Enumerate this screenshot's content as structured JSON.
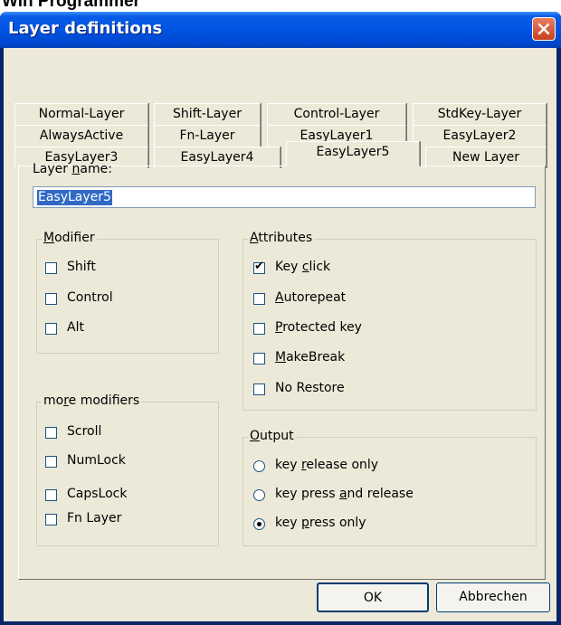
{
  "background_title": "Win Programmer",
  "window": {
    "title": "Layer definitions"
  },
  "tabs": {
    "row1": [
      "Normal-Layer",
      "Shift-Layer",
      "Control-Layer",
      "StdKey-Layer"
    ],
    "row2": [
      "AlwaysActive",
      "Fn-Layer",
      "EasyLayer1",
      "EasyLayer2"
    ],
    "row3": [
      "EasyLayer3",
      "EasyLayer4",
      "EasyLayer5",
      "New Layer"
    ],
    "selected": "EasyLayer5"
  },
  "layer_name": {
    "label_pre": "Layer ",
    "label_u": "n",
    "label_post": "ame:",
    "value": "EasyLayer5"
  },
  "modifier": {
    "legend_u": "M",
    "legend_rest": "odifier",
    "items": [
      {
        "label": "Shift",
        "checked": false
      },
      {
        "label": "Control",
        "checked": false
      },
      {
        "label": "Alt",
        "checked": false
      }
    ]
  },
  "more_modifiers": {
    "legend_pre": "mo",
    "legend_u": "r",
    "legend_post": "e modifiers",
    "items": [
      {
        "label": "Scroll",
        "checked": false
      },
      {
        "label": "NumLock",
        "checked": false
      },
      {
        "label": "CapsLock",
        "checked": false
      },
      {
        "label": "Fn Layer",
        "checked": false
      }
    ]
  },
  "attributes": {
    "legend_u": "A",
    "legend_rest": "ttributes",
    "items": [
      {
        "pre": "Key ",
        "u": "c",
        "post": "lick",
        "checked": true
      },
      {
        "pre": "",
        "u": "A",
        "post": "utorepeat",
        "checked": false
      },
      {
        "pre": "",
        "u": "P",
        "post": "rotected key",
        "checked": false
      },
      {
        "pre": "",
        "u": "M",
        "post": "akeBreak",
        "checked": false
      },
      {
        "pre": "No Restore",
        "u": "",
        "post": "",
        "checked": false
      }
    ]
  },
  "output": {
    "legend_u": "O",
    "legend_rest": "utput",
    "items": [
      {
        "pre": "key ",
        "u": "r",
        "post": "elease only",
        "checked": false
      },
      {
        "pre": "key press ",
        "u": "a",
        "post": "nd release",
        "checked": false
      },
      {
        "pre": "key ",
        "u": "p",
        "post": "ress only",
        "checked": true
      }
    ]
  },
  "buttons": {
    "ok": "OK",
    "cancel": "Abbrechen"
  }
}
